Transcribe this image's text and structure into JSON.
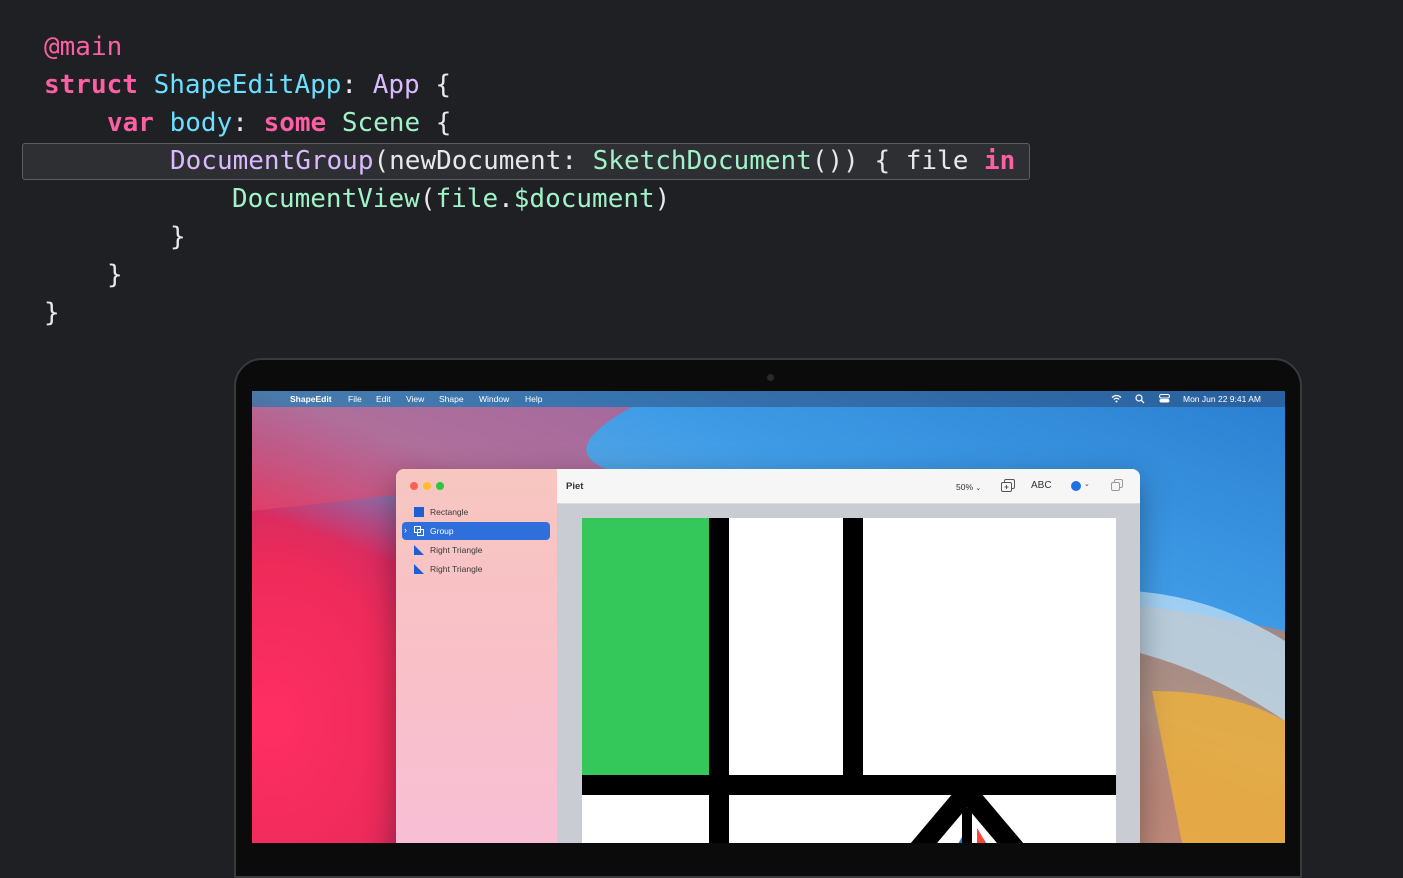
{
  "code": {
    "line1": {
      "attr": "@main"
    },
    "line2": {
      "kw": "struct",
      "name": "ShapeEditApp",
      "colon": ":",
      "proto": "App",
      "brace": "{"
    },
    "line3": {
      "kw": "var",
      "prop": "body",
      "colon": ":",
      "kw2": "some",
      "type": "Scene",
      "brace": "{"
    },
    "line4": {
      "call": "DocumentGroup",
      "open": "(",
      "arg": "newDocument",
      "colon": ":",
      "type": "SketchDocument",
      "parens": "())",
      "brace": "{",
      "param": "file",
      "kw": "in"
    },
    "line5": {
      "call": "DocumentView",
      "open": "(",
      "obj": "file",
      "dot": ".",
      "member": "$document",
      "close": ")"
    },
    "line6": "}",
    "line7": "}",
    "line8": "}"
  },
  "menubar": {
    "app_name": "ShapeEdit",
    "items": [
      "File",
      "Edit",
      "View",
      "Shape",
      "Window",
      "Help"
    ],
    "clock": "Mon Jun 22  9:41 AM"
  },
  "window": {
    "title": "Piet",
    "zoom": "50%",
    "text_tool": "ABC",
    "sidebar_items": [
      {
        "label": "Rectangle",
        "icon": "square-icon"
      },
      {
        "label": "Group",
        "icon": "group-icon",
        "selected": true
      },
      {
        "label": "Right Triangle",
        "icon": "triangle-icon"
      },
      {
        "label": "Right Triangle",
        "icon": "triangle-icon"
      }
    ]
  },
  "colors": {
    "keyword": "#fc5fa3",
    "type": "#6bdfff",
    "system": "#dabaff",
    "project": "#a2f2c8",
    "selection": "#2f6fdc",
    "piet_green": "#34c759",
    "piet_blue": "#1c7cf2",
    "piet_red": "#ff453a"
  }
}
